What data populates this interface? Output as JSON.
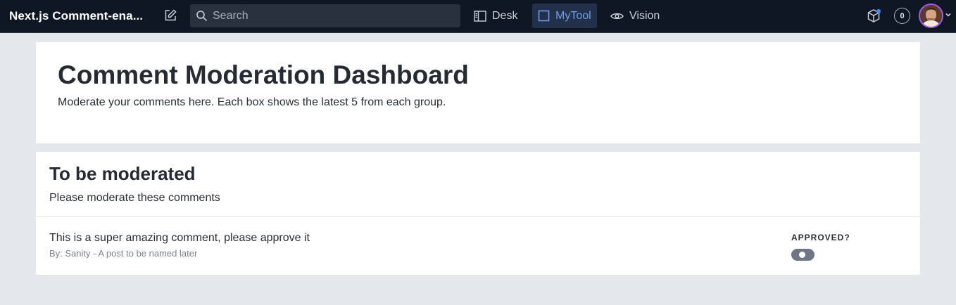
{
  "topbar": {
    "app_title": "Next.js Comment-ena...",
    "search_placeholder": "Search",
    "nav": [
      {
        "label": "Desk",
        "icon": "desk-icon",
        "active": false
      },
      {
        "label": "MyTool",
        "icon": "square-icon",
        "active": true
      },
      {
        "label": "Vision",
        "icon": "eye-icon",
        "active": false
      }
    ],
    "notification_count": "0",
    "accent_color": "#6f9be8"
  },
  "header": {
    "title": "Comment Moderation Dashboard",
    "subtitle": "Moderate your comments here. Each box shows the latest 5 from each group."
  },
  "queue": {
    "title": "To be moderated",
    "subtitle": "Please moderate these comments",
    "comments": [
      {
        "text": "This is a super amazing comment, please approve it",
        "meta": "By: Sanity - A post to be named later",
        "approved_label": "APPROVED?",
        "approved": false
      }
    ]
  }
}
